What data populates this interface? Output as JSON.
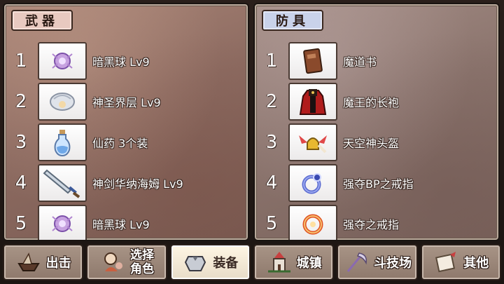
{
  "weapons": {
    "tab_label": "武器",
    "items": [
      {
        "index": "1",
        "name": "暗黑球 Lv9",
        "icon": "dark-orb-icon"
      },
      {
        "index": "2",
        "name": "神圣界层 Lv9",
        "icon": "holy-shell-icon"
      },
      {
        "index": "3",
        "name": "仙药 3个装",
        "icon": "potion-icon"
      },
      {
        "index": "4",
        "name": "神剑华纳海姆 Lv9",
        "icon": "sword-icon"
      },
      {
        "index": "5",
        "name": "暗黑球 Lv9",
        "icon": "dark-orb-icon"
      }
    ]
  },
  "armor": {
    "tab_label": "防具",
    "items": [
      {
        "index": "1",
        "name": "魔道书",
        "icon": "spellbook-icon"
      },
      {
        "index": "2",
        "name": "魔王的长袍",
        "icon": "demon-robe-icon"
      },
      {
        "index": "3",
        "name": "天空神头盔",
        "icon": "winged-helmet-icon"
      },
      {
        "index": "4",
        "name": "强夺BP之戒指",
        "icon": "blue-ring-icon"
      },
      {
        "index": "5",
        "name": "强夺之戒指",
        "icon": "red-ring-icon"
      }
    ]
  },
  "nav": {
    "sortie": "出击",
    "select_line1": "选择",
    "select_line2": "角色",
    "equip": "装备",
    "town": "城镇",
    "arena": "斗技场",
    "other": "其他"
  },
  "colors": {
    "weapons_tab": "#e8c9c0",
    "armor_tab": "#c9d2ea",
    "active_nav": "#fff6e4"
  }
}
